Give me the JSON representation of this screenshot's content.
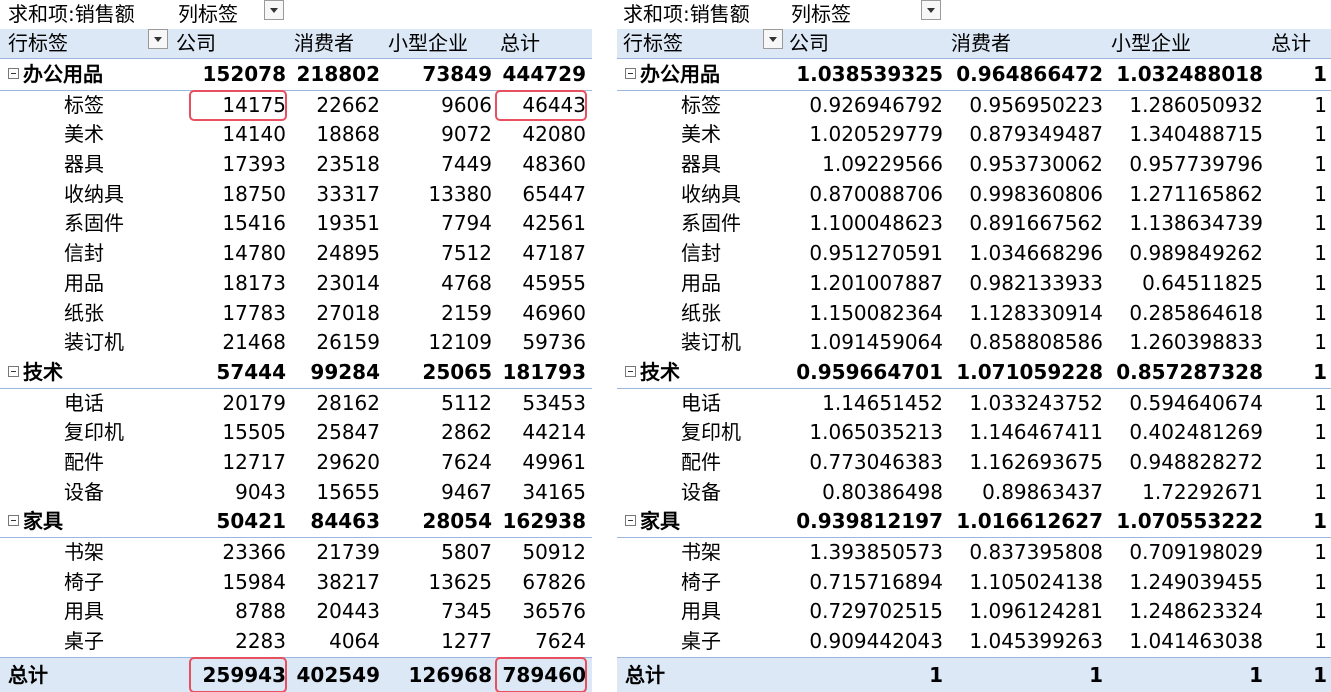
{
  "left": {
    "header1": {
      "sum_label": "求和项:销售额",
      "col_label": "列标签"
    },
    "header2": {
      "row_label": "行标签",
      "cols": [
        "公司",
        "消费者",
        "小型企业",
        "总计"
      ]
    },
    "rows": [
      {
        "type": "cat",
        "label": "办公用品",
        "v": [
          "152078",
          "218802",
          "73849",
          "444729"
        ]
      },
      {
        "type": "sub",
        "label": "标签",
        "v": [
          "14175",
          "22662",
          "9606",
          "46443"
        ]
      },
      {
        "type": "sub",
        "label": "美术",
        "v": [
          "14140",
          "18868",
          "9072",
          "42080"
        ]
      },
      {
        "type": "sub",
        "label": "器具",
        "v": [
          "17393",
          "23518",
          "7449",
          "48360"
        ]
      },
      {
        "type": "sub",
        "label": "收纳具",
        "v": [
          "18750",
          "33317",
          "13380",
          "65447"
        ]
      },
      {
        "type": "sub",
        "label": "系固件",
        "v": [
          "15416",
          "19351",
          "7794",
          "42561"
        ]
      },
      {
        "type": "sub",
        "label": "信封",
        "v": [
          "14780",
          "24895",
          "7512",
          "47187"
        ]
      },
      {
        "type": "sub",
        "label": "用品",
        "v": [
          "18173",
          "23014",
          "4768",
          "45955"
        ]
      },
      {
        "type": "sub",
        "label": "纸张",
        "v": [
          "17783",
          "27018",
          "2159",
          "46960"
        ]
      },
      {
        "type": "sub",
        "label": "装订机",
        "v": [
          "21468",
          "26159",
          "12109",
          "59736"
        ]
      },
      {
        "type": "cat",
        "label": "技术",
        "v": [
          "57444",
          "99284",
          "25065",
          "181793"
        ]
      },
      {
        "type": "sub",
        "label": "电话",
        "v": [
          "20179",
          "28162",
          "5112",
          "53453"
        ]
      },
      {
        "type": "sub",
        "label": "复印机",
        "v": [
          "15505",
          "25847",
          "2862",
          "44214"
        ]
      },
      {
        "type": "sub",
        "label": "配件",
        "v": [
          "12717",
          "29620",
          "7624",
          "49961"
        ]
      },
      {
        "type": "sub",
        "label": "设备",
        "v": [
          "9043",
          "15655",
          "9467",
          "34165"
        ]
      },
      {
        "type": "cat",
        "label": "家具",
        "v": [
          "50421",
          "84463",
          "28054",
          "162938"
        ]
      },
      {
        "type": "sub",
        "label": "书架",
        "v": [
          "23366",
          "21739",
          "5807",
          "50912"
        ]
      },
      {
        "type": "sub",
        "label": "椅子",
        "v": [
          "15984",
          "38217",
          "13625",
          "67826"
        ]
      },
      {
        "type": "sub",
        "label": "用具",
        "v": [
          "8788",
          "20443",
          "7345",
          "36576"
        ]
      },
      {
        "type": "sub",
        "label": "桌子",
        "v": [
          "2283",
          "4064",
          "1277",
          "7624"
        ]
      }
    ],
    "total": {
      "label": "总计",
      "v": [
        "259943",
        "402549",
        "126968",
        "789460"
      ]
    }
  },
  "right": {
    "header1": {
      "sum_label": "求和项:销售额",
      "col_label": "列标签"
    },
    "header2": {
      "row_label": "行标签",
      "cols": [
        "公司",
        "消费者",
        "小型企业",
        "总计"
      ]
    },
    "rows": [
      {
        "type": "cat",
        "label": "办公用品",
        "v": [
          "1.038539325",
          "0.964866472",
          "1.032488018",
          "1"
        ]
      },
      {
        "type": "sub",
        "label": "标签",
        "v": [
          "0.926946792",
          "0.956950223",
          "1.286050932",
          "1"
        ]
      },
      {
        "type": "sub",
        "label": "美术",
        "v": [
          "1.020529779",
          "0.879349487",
          "1.340488715",
          "1"
        ]
      },
      {
        "type": "sub",
        "label": "器具",
        "v": [
          "1.09229566",
          "0.953730062",
          "0.957739796",
          "1"
        ]
      },
      {
        "type": "sub",
        "label": "收纳具",
        "v": [
          "0.870088706",
          "0.998360806",
          "1.271165862",
          "1"
        ]
      },
      {
        "type": "sub",
        "label": "系固件",
        "v": [
          "1.100048623",
          "0.891667562",
          "1.138634739",
          "1"
        ]
      },
      {
        "type": "sub",
        "label": "信封",
        "v": [
          "0.951270591",
          "1.034668296",
          "0.989849262",
          "1"
        ]
      },
      {
        "type": "sub",
        "label": "用品",
        "v": [
          "1.201007887",
          "0.982133933",
          "0.64511825",
          "1"
        ]
      },
      {
        "type": "sub",
        "label": "纸张",
        "v": [
          "1.150082364",
          "1.128330914",
          "0.285864618",
          "1"
        ]
      },
      {
        "type": "sub",
        "label": "装订机",
        "v": [
          "1.091459064",
          "0.858808586",
          "1.260398833",
          "1"
        ]
      },
      {
        "type": "cat",
        "label": "技术",
        "v": [
          "0.959664701",
          "1.071059228",
          "0.857287328",
          "1"
        ]
      },
      {
        "type": "sub",
        "label": "电话",
        "v": [
          "1.14651452",
          "1.033243752",
          "0.594640674",
          "1"
        ]
      },
      {
        "type": "sub",
        "label": "复印机",
        "v": [
          "1.065035213",
          "1.146467411",
          "0.402481269",
          "1"
        ]
      },
      {
        "type": "sub",
        "label": "配件",
        "v": [
          "0.773046383",
          "1.162693675",
          "0.948828272",
          "1"
        ]
      },
      {
        "type": "sub",
        "label": "设备",
        "v": [
          "0.80386498",
          "0.89863437",
          "1.72292671",
          "1"
        ]
      },
      {
        "type": "cat",
        "label": "家具",
        "v": [
          "0.939812197",
          "1.016612627",
          "1.070553222",
          "1"
        ]
      },
      {
        "type": "sub",
        "label": "书架",
        "v": [
          "1.393850573",
          "0.837395808",
          "0.709198029",
          "1"
        ]
      },
      {
        "type": "sub",
        "label": "椅子",
        "v": [
          "0.715716894",
          "1.105024138",
          "1.249039455",
          "1"
        ]
      },
      {
        "type": "sub",
        "label": "用具",
        "v": [
          "0.729702515",
          "1.096124281",
          "1.248623324",
          "1"
        ]
      },
      {
        "type": "sub",
        "label": "桌子",
        "v": [
          "0.909442043",
          "1.045399263",
          "1.041463038",
          "1"
        ]
      }
    ],
    "total": {
      "label": "总计",
      "v": [
        "1",
        "1",
        "1",
        "1"
      ]
    }
  },
  "icons": {
    "dropdown": "filter-dropdown-icon",
    "collapse": "collapse-icon"
  },
  "colors": {
    "header_bg": "#dde8f6",
    "border": "#9bb7dd",
    "highlight": "#e9505f"
  }
}
